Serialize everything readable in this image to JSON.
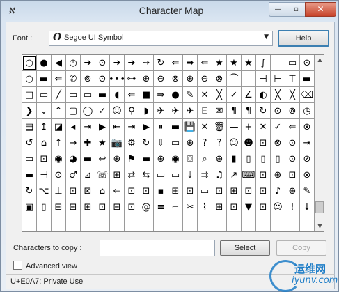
{
  "window": {
    "title": "Character Map",
    "app_icon": "character-map-icon",
    "min": "—",
    "max": "▫",
    "close": "✕"
  },
  "font": {
    "label": "Font :",
    "icon_glyph": "O",
    "value": "Segoe UI Symbol",
    "arrow": "▼"
  },
  "help_label": "Help",
  "grid": {
    "selected_index": 0,
    "glyphs": [
      "○",
      "●",
      "◀",
      "◷",
      "➔",
      "⊙",
      "➜",
      "➔",
      "➙",
      "↻",
      "⇐",
      "➡",
      "⇐",
      "★",
      "★",
      "★",
      "∫",
      "—",
      "▭",
      "⊙",
      "○",
      "▬",
      "⇐",
      "✆",
      "⊚",
      "⊙",
      "∙∙∙",
      "⊶",
      "⊕",
      "⊖",
      "⊗",
      "⊕",
      "⊖",
      "⊗",
      "⌒",
      "—",
      "⊣",
      "⊢",
      "⊤",
      "▬",
      "□",
      "▭",
      "╱",
      "▭",
      "▭",
      "▬",
      "◖",
      "⇐",
      "■",
      "⇛",
      "●",
      "✎",
      "✕",
      "╳",
      "✓",
      "∠",
      "◐",
      "╳",
      "╳",
      "⌫",
      "❯",
      "⌄",
      "⌃",
      "▢",
      "◯",
      "✓",
      "☺",
      "⚲",
      "◗",
      "✈",
      "✈",
      "✈",
      "⌸",
      "✉",
      "¶",
      "¶",
      "↻",
      "⊙",
      "⊚",
      "◷",
      "▤",
      "↥",
      "◪",
      "◂",
      "⇥",
      "▶",
      "⇤",
      "⇥",
      "▶",
      "⏸",
      "▬",
      "💾",
      "✕",
      "🗑",
      "—",
      "+",
      "✕",
      "✓",
      "⇐",
      "⊗",
      "↺",
      "⌂",
      "↑",
      "→",
      "✚",
      "★",
      "📷",
      "⚙",
      "↻",
      "⇩",
      "▭",
      "⊕",
      "?",
      "?",
      "☺",
      "☻",
      "⊡",
      "⊗",
      "⊙",
      "⇥",
      "▭",
      "⊡",
      "◉",
      "◕",
      "▬",
      "↩",
      "⊕",
      "⚑",
      "▬",
      "⊕",
      "◉",
      "⌼",
      "⌕",
      "⊕",
      "▮",
      "▯",
      "▯",
      "▯",
      "⊙",
      "⊘",
      "▬",
      "⊣",
      "⊙",
      "♂",
      "⊿",
      "☏",
      "⊞",
      "⇄",
      "⇆",
      "▭",
      "▭",
      "⇓",
      "⇉",
      "♫",
      "↗",
      "⌨",
      "⊡",
      "⊕",
      "⊡",
      "⊗",
      "↻",
      "⌥",
      "⊥",
      "⊡",
      "⊠",
      "⌂",
      "⇐",
      "⊡",
      "⊡",
      "▪",
      "⊞",
      "⊡",
      "▭",
      "⊡",
      "⊞",
      "⊡",
      "⊡",
      "♪",
      "⊕",
      "✎",
      "▣",
      "▯",
      "⊟",
      "⊟",
      "⊞",
      "⊡",
      "⊟",
      "⊡",
      "@",
      "≡",
      "⌐",
      "✂",
      "⌇",
      "⊞",
      "⊡",
      "▼",
      "⊡",
      "☺",
      "!",
      "↓",
      "",
      "",
      "",
      "",
      "",
      "",
      "",
      "",
      "",
      "",
      "",
      "",
      "",
      "",
      "",
      "",
      "",
      "",
      "",
      ""
    ]
  },
  "copy": {
    "label": "Characters to copy :",
    "value": "",
    "select": "Select",
    "copy": "Copy"
  },
  "advanced": {
    "label": "Advanced view"
  },
  "status": "U+E0A7: Private Use",
  "watermark": {
    "top": "运维网",
    "bottom": "iyunv.com"
  }
}
